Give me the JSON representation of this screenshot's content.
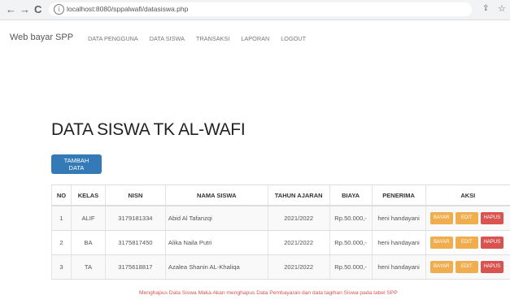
{
  "browser": {
    "back": "←",
    "forward": "→",
    "reload": "C",
    "info_icon": "i",
    "url": "localhost:8080/sppalwafi/datasiswa.php",
    "share_icon": "⇪",
    "star_icon": "☆"
  },
  "nav": {
    "brand": "Web bayar SPP",
    "items": [
      "DATA PENGGUNA",
      "DATA SISWA",
      "TRANSAKSI",
      "LAPORAN",
      "LOGOUT"
    ]
  },
  "page": {
    "title": "DATA SISWA TK AL-WAFI",
    "add_button": "TAMBAH DATA"
  },
  "table": {
    "headers": [
      "NO",
      "KELAS",
      "NISN",
      "NAMA SISWA",
      "TAHUN AJARAN",
      "BIAYA",
      "PENERIMA",
      "AKSI"
    ],
    "rows": [
      {
        "no": "1",
        "kelas": "ALIF",
        "nisn": "3179181334",
        "nama": "Abid Al Tafanzqi",
        "tahun": "2021/2022",
        "biaya": "Rp.50.000,-",
        "penerima": "heni handayani"
      },
      {
        "no": "2",
        "kelas": "BA",
        "nisn": "3175817450",
        "nama": "Alika Naila Putri",
        "tahun": "2021/2022",
        "biaya": "Rp.50.000,-",
        "penerima": "heni handayani"
      },
      {
        "no": "3",
        "kelas": "TA",
        "nisn": "3175618817",
        "nama": "Azalea Shanin AL-Khaliqa",
        "tahun": "2021/2022",
        "biaya": "Rp.50.000,-",
        "penerima": "heni handayani"
      }
    ],
    "actions": {
      "bayar": "BAYAR",
      "edit": "EDIT",
      "hapus": "HAPUS"
    }
  },
  "notice": "Menghapus Data Siswa Maka Akan menghapus Data Pembayaran dan data tagihan Siswa pada tabel SPP",
  "colors": {
    "primary": "#337ab7",
    "warning": "#f0ad4e",
    "danger": "#d9534f"
  }
}
